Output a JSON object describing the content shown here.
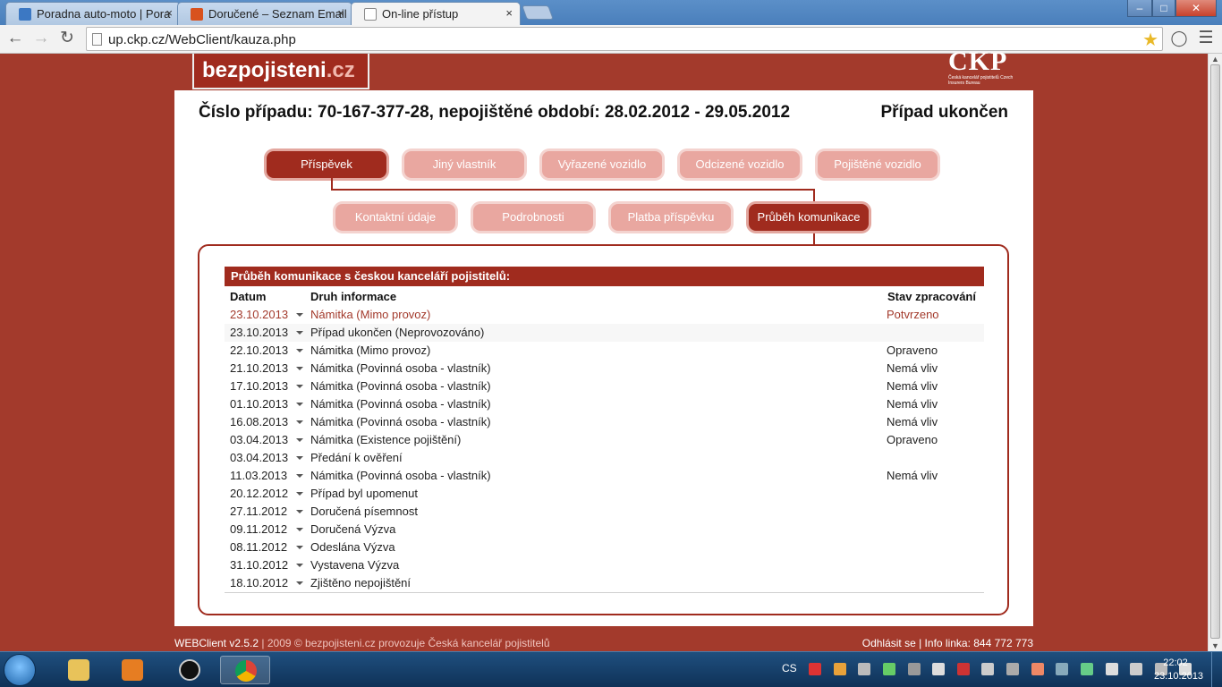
{
  "browser": {
    "tabs": [
      {
        "title": "Poradna auto-moto | Pora",
        "icon_color": "#3c78c3"
      },
      {
        "title": "Doručené – Seznam Email",
        "icon_color": "#d8521e"
      },
      {
        "title": "On-line přístup",
        "icon_color": "#8a8a8a"
      }
    ],
    "close_glyph": "×",
    "url": "up.ckp.cz/WebClient/kauza.php",
    "window_buttons": [
      "‒",
      "□",
      "✕"
    ]
  },
  "header": {
    "logo_main": "bezpojisteni",
    "logo_tld": ".cz",
    "ckp_logo": "CKP",
    "ckp_sub": "Česká kancelář pojistitelů Czech Insurers Bureau"
  },
  "case": {
    "title": "Číslo případu: 70-167-377-28, nepojištěné období: 28.02.2012 - 29.05.2012",
    "status": "Případ ukončen"
  },
  "nav_top": [
    "Příspěvek",
    "Jiný vlastník",
    "Vyřazené vozidlo",
    "Odcizené vozidlo",
    "Pojištěné vozidlo"
  ],
  "nav_sub": [
    "Kontaktní údaje",
    "Podrobnosti",
    "Platba příspěvku",
    "Průběh komunikace"
  ],
  "panel": {
    "heading": "Průběh komunikace s českou kanceláří pojistitelů:",
    "columns": {
      "date": "Datum",
      "type": "Druh informace",
      "state": "Stav zpracování"
    },
    "rows": [
      {
        "date": "23.10.2013",
        "type": "Námitka (Mimo provoz)",
        "state": "Potvrzeno"
      },
      {
        "date": "23.10.2013",
        "type": "Případ ukončen (Neprovozováno)",
        "state": ""
      },
      {
        "date": "22.10.2013",
        "type": "Námitka (Mimo provoz)",
        "state": "Opraveno"
      },
      {
        "date": "21.10.2013",
        "type": "Námitka (Povinná osoba - vlastník)",
        "state": "Nemá vliv"
      },
      {
        "date": "17.10.2013",
        "type": "Námitka (Povinná osoba - vlastník)",
        "state": "Nemá vliv"
      },
      {
        "date": "01.10.2013",
        "type": "Námitka (Povinná osoba - vlastník)",
        "state": "Nemá vliv"
      },
      {
        "date": "16.08.2013",
        "type": "Námitka (Povinná osoba - vlastník)",
        "state": "Nemá vliv"
      },
      {
        "date": "03.04.2013",
        "type": "Námitka (Existence pojištění)",
        "state": "Opraveno"
      },
      {
        "date": "03.04.2013",
        "type": "Předání k ověření",
        "state": ""
      },
      {
        "date": "11.03.2013",
        "type": "Námitka (Povinná osoba - vlastník)",
        "state": "Nemá vliv"
      },
      {
        "date": "20.12.2012",
        "type": "Případ byl upomenut",
        "state": ""
      },
      {
        "date": "27.11.2012",
        "type": "Doručená písemnost",
        "state": ""
      },
      {
        "date": "09.11.2012",
        "type": "Doručená Výzva",
        "state": ""
      },
      {
        "date": "08.11.2012",
        "type": "Odeslána Výzva",
        "state": ""
      },
      {
        "date": "31.10.2012",
        "type": "Vystavena Výzva",
        "state": ""
      },
      {
        "date": "18.10.2012",
        "type": "Zjištěno nepojištění",
        "state": ""
      }
    ]
  },
  "footer": {
    "version": "WEBClient v2.5.2",
    "copyright": "| 2009 © bezpojisteni.cz provozuje Česká kancelář pojistitelů",
    "logout": "Odhlásit se",
    "hotline": "| Info linka: 844 772 773"
  },
  "taskbar": {
    "lang": "CS",
    "time": "22:02",
    "date": "23.10.2013"
  },
  "colors": {
    "brand": "#a02b1e",
    "background": "#a33a2c",
    "pill_inactive": "#e9a7a0"
  }
}
